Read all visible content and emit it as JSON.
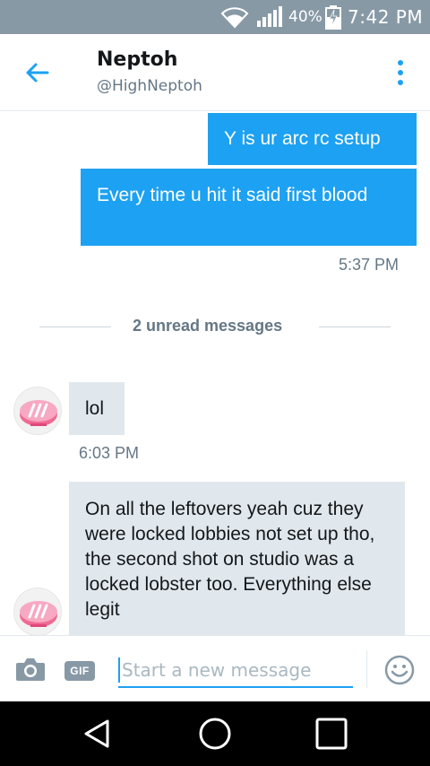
{
  "status_bar": {
    "battery_percent": "40%",
    "time": "7:42 PM"
  },
  "header": {
    "name": "Neptoh",
    "handle": "@HighNeptoh"
  },
  "messages": [
    {
      "direction": "sent",
      "text": "Y is ur arc rc setup"
    },
    {
      "direction": "sent",
      "text": "Every time u hit it said first blood",
      "time": "5:37 PM"
    },
    {
      "direction": "received",
      "text": "lol",
      "time": "6:03 PM"
    },
    {
      "direction": "received",
      "text": "On all the leftovers yeah cuz they were locked lobbies not set up tho, the second shot on studio was a locked lobster too. Everything else legit"
    }
  ],
  "unread_divider": "2 unread messages",
  "composer": {
    "placeholder": "Start a new message",
    "gif_label": "GIF"
  },
  "colors": {
    "accent": "#1da1f2",
    "status_bar": "#8899a6",
    "received_bubble": "#e1e8ed",
    "secondary_text": "#657786"
  },
  "icons": [
    "wifi-icon",
    "signal-icon",
    "battery-charging-icon",
    "back-arrow-icon",
    "more-vertical-icon",
    "camera-icon",
    "emoji-icon",
    "nav-back-icon",
    "nav-home-icon",
    "nav-recent-icon"
  ]
}
